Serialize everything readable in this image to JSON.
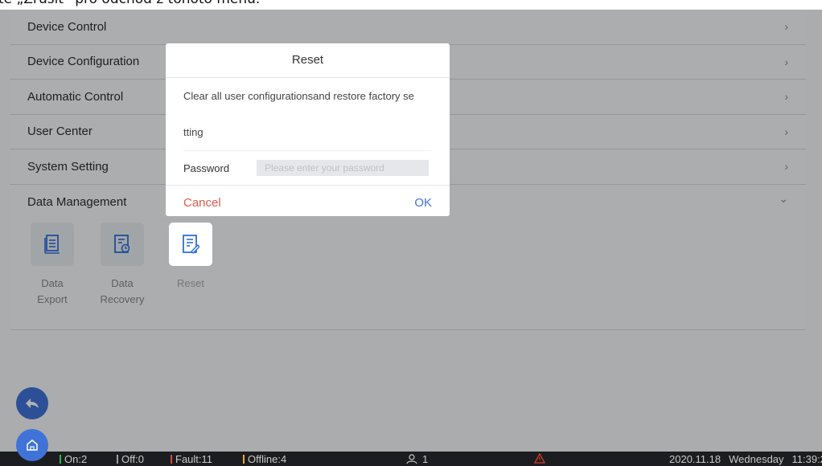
{
  "document_text": "te „Zrušit“ pro odchod z tohoto menu.",
  "menu": {
    "items": [
      {
        "label": "Device Control",
        "icon": "chevron-right-icon"
      },
      {
        "label": "Device Configuration",
        "icon": "chevron-right-icon"
      },
      {
        "label": "Automatic Control",
        "icon": "chevron-right-icon"
      },
      {
        "label": "User Center",
        "icon": "chevron-right-icon"
      },
      {
        "label": "System Setting",
        "icon": "chevron-right-icon"
      },
      {
        "label": "Data Management",
        "icon": "chevron-down-icon"
      }
    ],
    "chevron_right": "›",
    "chevron_down": "⌄"
  },
  "data_management": {
    "tiles": [
      {
        "label_line1": "Data",
        "label_line2": "Export",
        "icon": "data-export-icon"
      },
      {
        "label_line1": "Data",
        "label_line2": "Recovery",
        "icon": "data-recovery-icon"
      },
      {
        "label_line1": "Reset",
        "label_line2": "",
        "icon": "reset-icon"
      }
    ]
  },
  "dialog": {
    "title": "Reset",
    "message_line1": "Clear all user configurationsand restore factory se",
    "message_line2": "tting",
    "password_label": "Password",
    "password_placeholder": "Please enter your password",
    "cancel_label": "Cancel",
    "ok_label": "OK"
  },
  "floating_buttons": {
    "back": "back-arrow-icon",
    "home": "home-icon"
  },
  "status_bar": {
    "on": "On:2",
    "off": "Off:0",
    "fault": "Fault:11",
    "offline": "Offline:4",
    "users": "1",
    "date": "2020.11.18",
    "weekday": "Wednesday",
    "time": "11:39:2"
  },
  "colors": {
    "accent": "#3f73d8",
    "cancel": "#e05a4a",
    "ok": "#3f73d8",
    "on": "#39b54a",
    "off": "#9aa0a6",
    "fault": "#e0463a",
    "offline": "#e8b02c",
    "warning": "#d93a2b"
  }
}
